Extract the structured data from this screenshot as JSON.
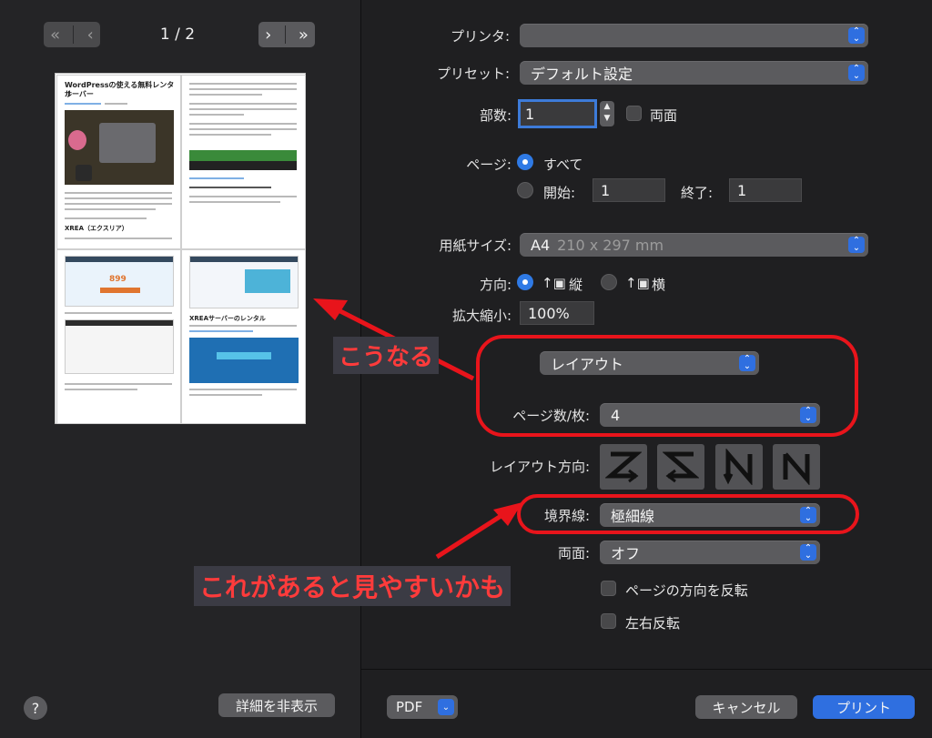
{
  "preview": {
    "page_indicator": "1 / 2",
    "hide_details_label": "詳細を非表示",
    "help_label": "?",
    "page": {
      "title_line1": "WordPressの使える無料レンタル",
      "title_line2": "サーバー",
      "cell3_heading": "XREA（エクスリア）",
      "cell4_heading": "XREAサーバーのレンタル",
      "price": "899"
    }
  },
  "settings": {
    "printer_label": "プリンタ:",
    "printer_value": "",
    "preset_label": "プリセット:",
    "preset_value": "デフォルト設定",
    "copies_label": "部数:",
    "copies_value": "1",
    "duplex_check_label": "両面",
    "pages_label": "ページ:",
    "pages_all_label": "すべて",
    "pages_from_label": "開始:",
    "pages_from_value": "1",
    "pages_to_label": "終了:",
    "pages_to_value": "1",
    "paper_size_label": "用紙サイズ:",
    "paper_size_value": "A4",
    "paper_size_dim": "210 x 297 mm",
    "orientation_label": "方向:",
    "orientation_portrait": "縦",
    "orientation_landscape": "横",
    "scale_label": "拡大縮小:",
    "scale_value": "100%",
    "section_popup_value": "レイアウト",
    "pages_per_sheet_label": "ページ数/枚:",
    "pages_per_sheet_value": "4",
    "layout_direction_label": "レイアウト方向:",
    "border_label": "境界線:",
    "border_value": "極細線",
    "two_sided_label": "両面:",
    "two_sided_value": "オフ",
    "reverse_orientation_label": "ページの方向を反転",
    "flip_horizontal_label": "左右反転"
  },
  "footer": {
    "pdf_label": "PDF",
    "cancel_label": "キャンセル",
    "print_label": "プリント"
  },
  "annotations": {
    "callout_result": "こうなる",
    "callout_border": "これがあると見やすいかも",
    "color": "#e8141b"
  }
}
